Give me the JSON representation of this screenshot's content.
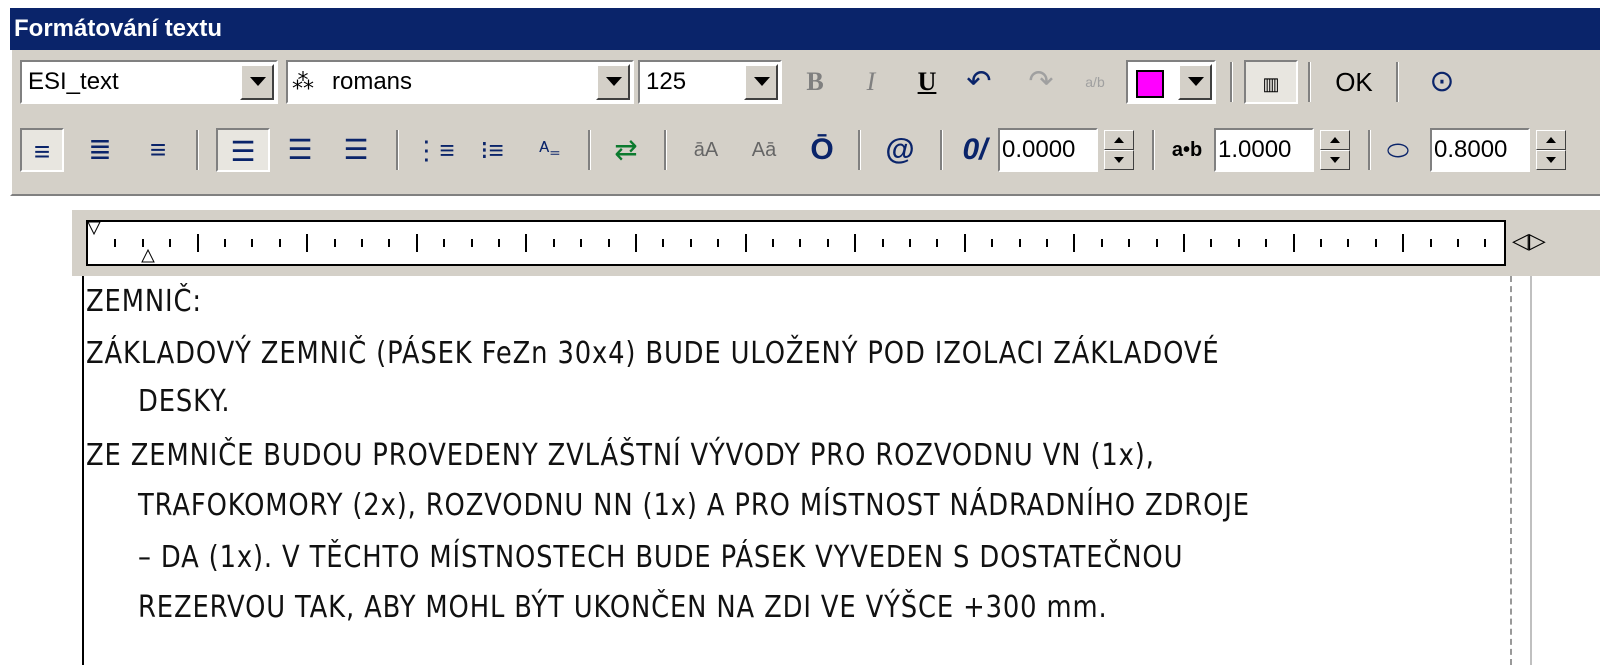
{
  "window": {
    "title": "Formátování textu"
  },
  "toolbar": {
    "style_value": "ESI_text",
    "font_value": "romans",
    "font_icon": "font-aa-icon",
    "height_value": "125",
    "bold_label": "B",
    "italic_label": "I",
    "underline_label": "U",
    "undo_glyph": "↶",
    "redo_glyph": "↷",
    "stack_glyph": "a/b",
    "color_swatch": "#ff00ff",
    "ok_label": "OK",
    "options_glyph": "⊙",
    "oblique_label": "0/",
    "oblique_value": "0.0000",
    "tracking_label": "a•b",
    "tracking_value": "1.0000",
    "width_value": "0.8000",
    "uppercase_label": "āA",
    "lowercase_label": "Aā",
    "overline_label": "Ō",
    "symbol_label": "@"
  },
  "colors": {
    "titlebar": "#0a246a",
    "face": "#d4d0c8",
    "swatch": "#ff00ff"
  },
  "editor": {
    "lines": [
      "ZEMNIČ:",
      "ZÁKLADOVÝ ZEMNIČ (PÁSEK FeZn 30x4) BUDE ULOŽENÝ POD IZOLACI ZÁKLADOVÉ",
      "DESKY.",
      "ZE ZEMNIČE BUDOU PROVEDENY ZVLÁŠTNÍ VÝVODY PRO ROZVODNU VN (1x),",
      "TRAFOKOMORY (2x), ROZVODNU NN (1x) A PRO MÍSTNOST NÁDRADNÍHO ZDROJE",
      "– DA (1x). V TĚCHTO MÍSTNOSTECH BUDE PÁSEK VYVEDEN S DOSTATEČNOU",
      "REZERVOU TAK, ABY MOHL BÝT UKONČEN NA ZDI VE VÝŠCE +300 mm."
    ]
  }
}
